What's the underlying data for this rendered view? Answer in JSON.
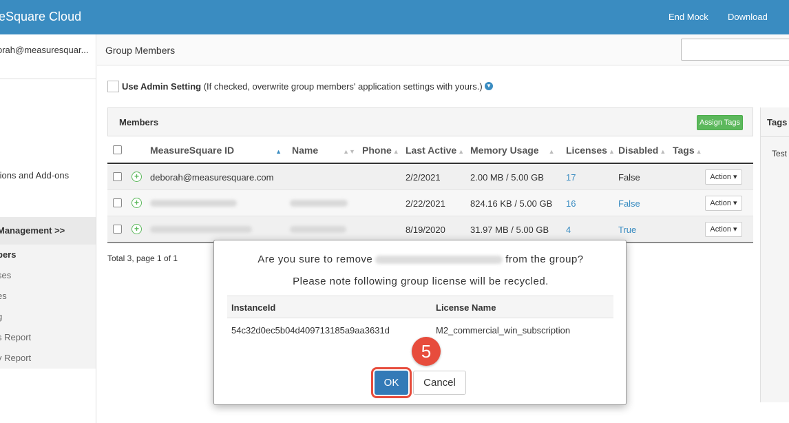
{
  "header": {
    "brand": "eSquare Cloud",
    "end_mock": "End Mock",
    "download": "Download",
    "accent": "#3a8cc1"
  },
  "sidebar": {
    "user": "orah@measuresquar...",
    "items": [
      {
        "label": "tions and Add-ons"
      },
      {
        "label": "Management >>"
      }
    ],
    "sub_items": [
      {
        "label": "bers"
      },
      {
        "label": "ses"
      },
      {
        "label": "es"
      },
      {
        "label": "g"
      },
      {
        "label": "s Report"
      },
      {
        "label": "y Report"
      }
    ]
  },
  "page": {
    "title": "Group Members",
    "admin_setting_label": "Use Admin Setting",
    "admin_setting_hint": "(If checked, overwrite group members' application settings with yours.)",
    "members_title": "Members",
    "assign_tags": "Assign Tags",
    "total": "Total 3, page 1 of 1",
    "tags_title": "Tags",
    "tags_item": "Test"
  },
  "table": {
    "columns": {
      "id": "MeasureSquare ID",
      "name": "Name",
      "phone": "Phone",
      "last_active": "Last Active",
      "memory": "Memory Usage",
      "licenses": "Licenses",
      "disabled": "Disabled",
      "tags": "Tags"
    },
    "rows": [
      {
        "id": "deborah@measuresquare.com",
        "last_active": "2/2/2021",
        "memory": "2.00 MB / 5.00 GB",
        "licenses": "17",
        "disabled": "False",
        "action": "Action ▾"
      },
      {
        "id": "",
        "last_active": "2/22/2021",
        "memory": "824.16 KB / 5.00 GB",
        "licenses": "16",
        "disabled": "False",
        "action": "Action ▾"
      },
      {
        "id": "",
        "last_active": "8/19/2020",
        "memory": "31.97 MB / 5.00 GB",
        "licenses": "4",
        "disabled": "True",
        "action": "Action ▾"
      }
    ]
  },
  "dialog": {
    "line1_prefix": "Are you sure to remove",
    "line1_suffix": "from the group?",
    "line2": "Please note following group license will be recycled.",
    "col_instance": "InstanceId",
    "col_license": "License Name",
    "instance_id": "54c32d0ec5b04d409713185a9aa3631d",
    "license_name": "M2_commercial_win_subscription",
    "ok": "OK",
    "cancel": "Cancel",
    "step": "5"
  }
}
